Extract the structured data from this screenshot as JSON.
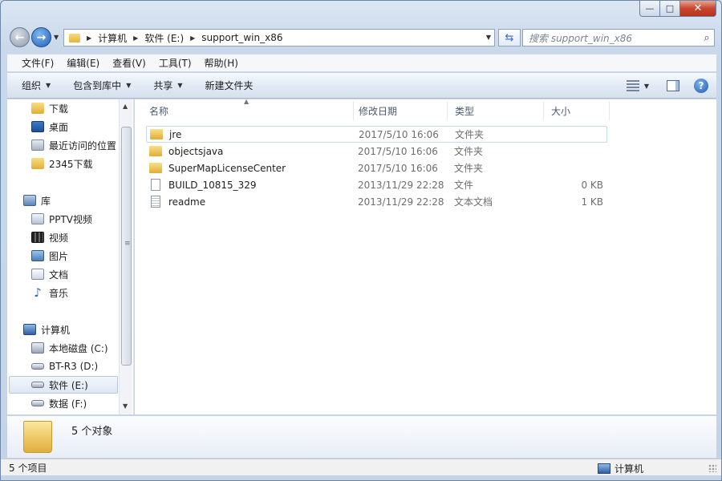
{
  "caption": {
    "minimize": "—",
    "maximize": "□",
    "close": "✕"
  },
  "address": {
    "crumbs": [
      "计算机",
      "软件 (E:)",
      "support_win_x86"
    ],
    "search_placeholder": "搜索 support_win_x86"
  },
  "menu": [
    "文件(F)",
    "编辑(E)",
    "查看(V)",
    "工具(T)",
    "帮助(H)"
  ],
  "commands": [
    {
      "label": "组织",
      "has_dropdown": true
    },
    {
      "label": "包含到库中",
      "has_dropdown": true
    },
    {
      "label": "共享",
      "has_dropdown": true
    },
    {
      "label": "新建文件夹",
      "has_dropdown": false
    }
  ],
  "nav_pane": {
    "favorites": [
      {
        "label": "下载",
        "icon": "download-folder-icon"
      },
      {
        "label": "桌面",
        "icon": "desktop-icon"
      },
      {
        "label": "最近访问的位置",
        "icon": "recent-places-icon"
      },
      {
        "label": "2345下载",
        "icon": "folder-icon"
      }
    ],
    "libraries_label": "库",
    "libraries": [
      {
        "label": "PPTV视频",
        "icon": "pptv-icon"
      },
      {
        "label": "视频",
        "icon": "video-library-icon"
      },
      {
        "label": "图片",
        "icon": "picture-library-icon"
      },
      {
        "label": "文档",
        "icon": "document-library-icon"
      },
      {
        "label": "音乐",
        "icon": "music-library-icon"
      }
    ],
    "computer_label": "计算机",
    "drives": [
      {
        "label": "本地磁盘 (C:)",
        "icon": "system-drive-icon"
      },
      {
        "label": "BT-R3 (D:)",
        "icon": "drive-icon"
      },
      {
        "label": "软件 (E:)",
        "icon": "drive-icon",
        "selected": true
      },
      {
        "label": "数据 (F:)",
        "icon": "drive-icon"
      }
    ]
  },
  "columns": {
    "name": "名称",
    "date": "修改日期",
    "type": "类型",
    "size": "大小"
  },
  "files": [
    {
      "name": "jre",
      "date": "2017/5/10 16:06",
      "type": "文件夹",
      "size": "",
      "kind": "folder",
      "selected": true
    },
    {
      "name": "objectsjava",
      "date": "2017/5/10 16:06",
      "type": "文件夹",
      "size": "",
      "kind": "folder"
    },
    {
      "name": "SuperMapLicenseCenter",
      "date": "2017/5/10 16:06",
      "type": "文件夹",
      "size": "",
      "kind": "folder"
    },
    {
      "name": "BUILD_10815_329",
      "date": "2013/11/29 22:28",
      "type": "文件",
      "size": "0 KB",
      "kind": "file"
    },
    {
      "name": "readme",
      "date": "2013/11/29 22:28",
      "type": "文本文档",
      "size": "1 KB",
      "kind": "text"
    }
  ],
  "details": {
    "summary": "5 个对象"
  },
  "status": {
    "items_count": "5 个项目",
    "location": "计算机"
  },
  "colors": {
    "accent": "#2d6ac9",
    "folder": "#e0ae38",
    "selection_border": "#c9d8ec"
  }
}
